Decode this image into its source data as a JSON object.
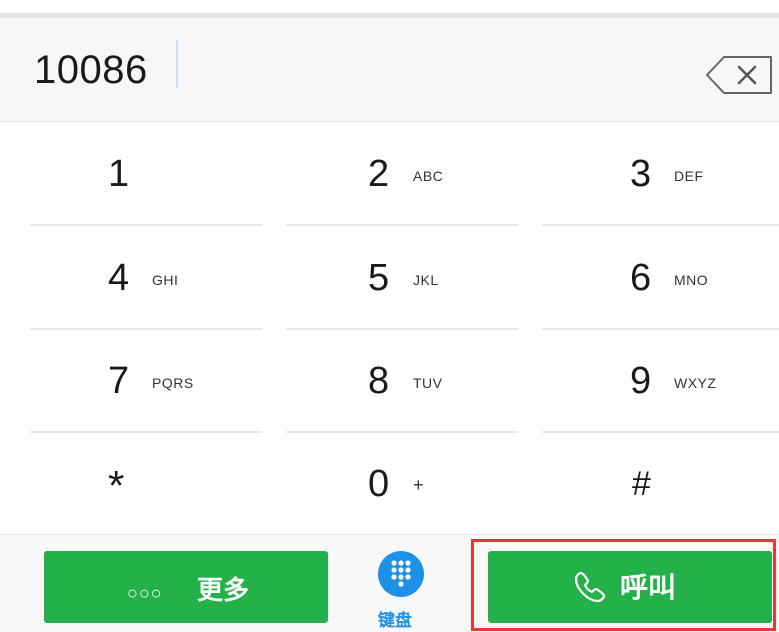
{
  "dialer": {
    "number": "10086",
    "backspace_icon": "backspace-icon"
  },
  "keypad": {
    "rows": [
      [
        {
          "digit": "1",
          "letters": ""
        },
        {
          "digit": "2",
          "letters": "ABC"
        },
        {
          "digit": "3",
          "letters": "DEF"
        }
      ],
      [
        {
          "digit": "4",
          "letters": "GHI"
        },
        {
          "digit": "5",
          "letters": "JKL"
        },
        {
          "digit": "6",
          "letters": "MNO"
        }
      ],
      [
        {
          "digit": "7",
          "letters": "PQRS"
        },
        {
          "digit": "8",
          "letters": "TUV"
        },
        {
          "digit": "9",
          "letters": "WXYZ"
        }
      ],
      [
        {
          "digit": "*",
          "letters": ""
        },
        {
          "digit": "0",
          "letters": "+"
        },
        {
          "digit": "#",
          "letters": ""
        }
      ]
    ]
  },
  "bottom_bar": {
    "more": {
      "dots": "○○○",
      "label": "更多"
    },
    "keyboard": {
      "label": "键盘",
      "icon": "keypad-grid-icon"
    },
    "call": {
      "label": "呼叫",
      "icon": "phone-icon"
    }
  },
  "colors": {
    "green": "#25b14a",
    "blue": "#1e90e6",
    "highlight": "#e53935"
  }
}
